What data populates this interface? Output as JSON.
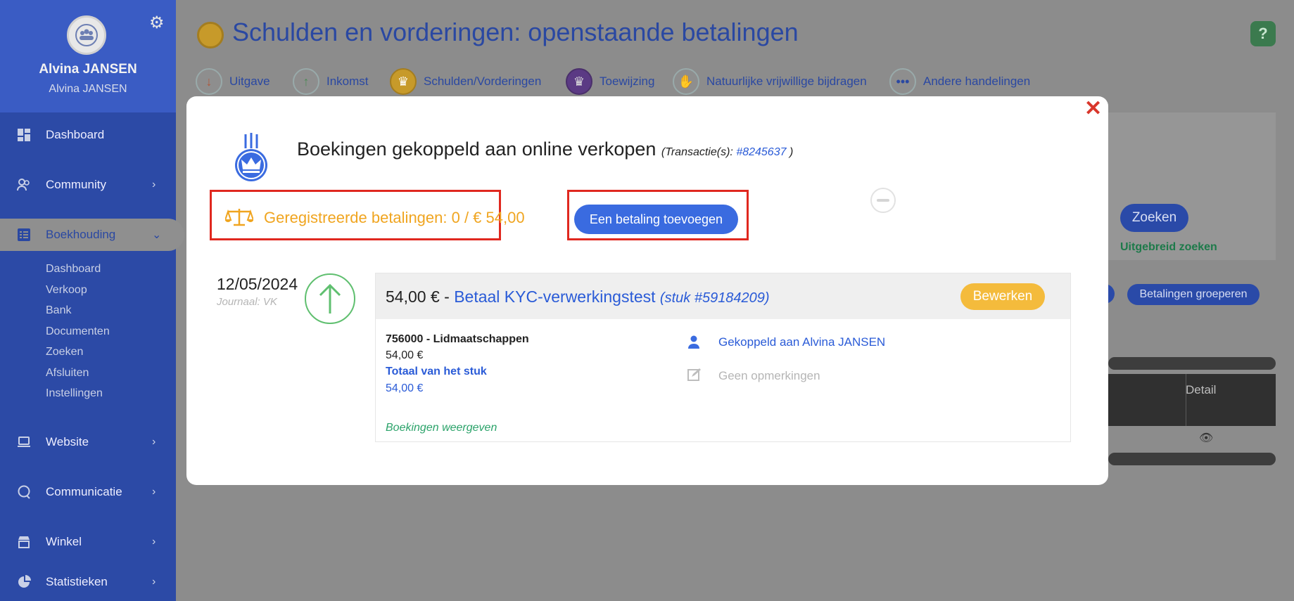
{
  "sidebar": {
    "user_name": "Alvina JANSEN",
    "user_subname": "Alvina JANSEN",
    "items": [
      {
        "label": "Dashboard"
      },
      {
        "label": "Community"
      },
      {
        "label": "Boekhouding"
      },
      {
        "label": "Website"
      },
      {
        "label": "Communicatie"
      },
      {
        "label": "Winkel"
      },
      {
        "label": "Statistieken"
      }
    ],
    "sub_items": [
      "Dashboard",
      "Verkoop",
      "Bank",
      "Documenten",
      "Zoeken",
      "Afsluiten",
      "Instellingen"
    ]
  },
  "page": {
    "title": "Schulden en vorderingen: openstaande betalingen",
    "help": "?",
    "actions": [
      "Uitgave",
      "Inkomst",
      "Schulden/Vorderingen",
      "Toewijzing",
      "Natuurlijke vrijwillige bijdragen",
      "Andere handelingen"
    ],
    "search_button": "Zoeken",
    "advanced_search": "Uitgebreid zoeken",
    "group_payments": "Betalingen groeperen",
    "detail_header": "Detail"
  },
  "modal": {
    "title": "Boekingen gekoppeld aan online verkopen",
    "trans_prefix": "(Transactie(s): ",
    "trans_id": "#8245637",
    "trans_suffix": " )",
    "registered": "Geregistreerde betalingen: 0 / € 54,00",
    "add_payment": "Een betaling toevoegen",
    "date": "12/05/2024",
    "journal": "Journaal: VK",
    "entry": {
      "amount": "54,00 € - ",
      "link": "Betaal KYC-verwerkingstest",
      "stuk": "(stuk #59184209)",
      "edit": "Bewerken",
      "account": "756000 - Lidmaatschappen",
      "account_amount": "54,00 €",
      "total_label": "Totaal van het stuk",
      "total_amount": "54,00 €",
      "show_bookings": "Boekingen weergeven",
      "linked_to": "Gekoppeld aan Alvina JANSEN",
      "no_notes": "Geen opmerkingen"
    }
  },
  "colors": {
    "sidebar": "#2c4aa6",
    "accent_blue": "#3a6be0",
    "orange": "#f0a520",
    "highlight_red": "#e0281f",
    "green": "#5fbf6f"
  }
}
